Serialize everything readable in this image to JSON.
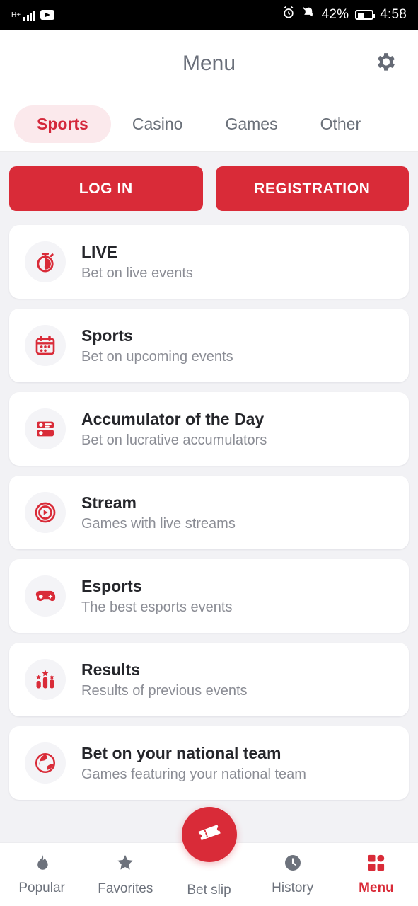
{
  "status_bar": {
    "network": "H+",
    "youtube_icon": "youtube-icon",
    "alarm_icon": "alarm-icon",
    "mute_icon": "bell-muted-icon",
    "battery_percent": "42%",
    "time": "4:58"
  },
  "header": {
    "title": "Menu",
    "settings_icon": "gear-icon"
  },
  "tabs": [
    {
      "label": "Sports",
      "active": true
    },
    {
      "label": "Casino",
      "active": false
    },
    {
      "label": "Games",
      "active": false
    },
    {
      "label": "Other",
      "active": false
    }
  ],
  "auth": {
    "login_label": "LOG IN",
    "registration_label": "REGISTRATION"
  },
  "menu_items": [
    {
      "icon": "stopwatch-icon",
      "title": "LIVE",
      "subtitle": "Bet on live events"
    },
    {
      "icon": "calendar-icon",
      "title": "Sports",
      "subtitle": "Bet on upcoming events"
    },
    {
      "icon": "accumulator-list-icon",
      "title": "Accumulator of the Day",
      "subtitle": "Bet on lucrative accumulators"
    },
    {
      "icon": "play-circle-icon",
      "title": "Stream",
      "subtitle": "Games with live streams"
    },
    {
      "icon": "gamepad-icon",
      "title": "Esports",
      "subtitle": "The best esports events"
    },
    {
      "icon": "podium-stars-icon",
      "title": "Results",
      "subtitle": "Results of previous events"
    },
    {
      "icon": "globe-ball-icon",
      "title": "Bet on your national team",
      "subtitle": "Games featuring your national team"
    }
  ],
  "bottom_nav": [
    {
      "icon": "flame-icon",
      "label": "Popular",
      "active": false
    },
    {
      "icon": "star-icon",
      "label": "Favorites",
      "active": false
    },
    {
      "icon": "ticket-icon",
      "label": "Bet slip",
      "active": false
    },
    {
      "icon": "clock-icon",
      "label": "History",
      "active": false
    },
    {
      "icon": "grid-icon",
      "label": "Menu",
      "active": true
    }
  ],
  "colors": {
    "brand_red": "#d92b38",
    "tab_active_bg": "#fbe9ec",
    "tab_active_text": "#d4283b",
    "page_bg": "#f2f2f5",
    "card_bg": "#ffffff",
    "title_text": "#25262b",
    "subtitle_text": "#8b8d95",
    "nav_inactive": "#6d727c"
  }
}
